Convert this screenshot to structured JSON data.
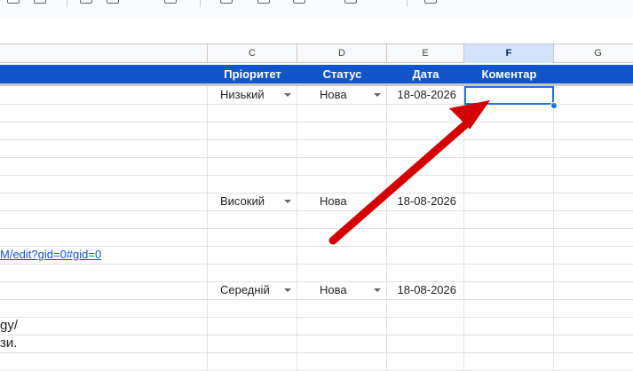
{
  "columns": {
    "c": "C",
    "d": "D",
    "e": "E",
    "f": "F",
    "g": "G"
  },
  "header": {
    "priority": "Пріоритет",
    "status": "Статус",
    "date": "Дата",
    "comment": "Коментар"
  },
  "rows": {
    "r1": {
      "priority": "Низький",
      "status": "Нова",
      "date": "18-08-2026"
    },
    "r7": {
      "priority": "Високий",
      "status": "Нова",
      "date": "18-08-2026"
    },
    "r10": {
      "link": "M/edit?gid=0#gid=0"
    },
    "r12": {
      "priority": "Середній",
      "status": "Нова",
      "date": "18-08-2026"
    },
    "r14": {
      "text": "gy/"
    },
    "r15": {
      "text": "зи."
    }
  },
  "colors": {
    "header_bg": "#1155cc",
    "selection": "#1a73e8",
    "annotation_arrow": "#d40000"
  },
  "icons": {
    "dropdown": "chevron-down-icon",
    "annotation": "annotation-arrow-icon"
  }
}
